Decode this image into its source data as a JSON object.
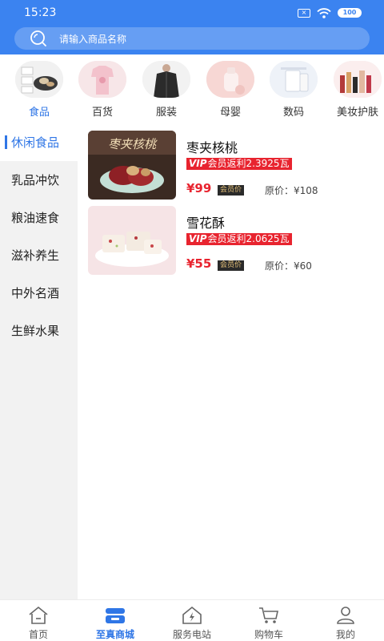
{
  "status": {
    "time": "15:23",
    "battery": "100"
  },
  "search": {
    "placeholder": "请输入商品名称"
  },
  "categories": [
    {
      "label": "食品",
      "active": true
    },
    {
      "label": "百货"
    },
    {
      "label": "服装"
    },
    {
      "label": "母婴"
    },
    {
      "label": "数码"
    },
    {
      "label": "美妆护肤"
    }
  ],
  "sidebar": {
    "items": [
      {
        "label": "休闲食品",
        "active": true
      },
      {
        "label": "乳品冲饮"
      },
      {
        "label": "粮油速食"
      },
      {
        "label": "滋补养生"
      },
      {
        "label": "中外名酒"
      },
      {
        "label": "生鲜水果"
      }
    ]
  },
  "products": [
    {
      "name": "枣夹核桃",
      "image_text": "枣夹核桃",
      "vip_mark": "VIP",
      "vip_text": "会员返利2.3925瓦",
      "price": "¥99",
      "member_tag": "会员价",
      "original_price": "原价：¥108"
    },
    {
      "name": "雪花酥",
      "vip_mark": "VIP",
      "vip_text": "会员返利2.0625瓦",
      "price": "¥55",
      "member_tag": "会员价",
      "original_price": "原价：¥60"
    }
  ],
  "tabbar": {
    "items": [
      {
        "label": "首页",
        "icon": "home-icon"
      },
      {
        "label": "至真商城",
        "icon": "store-icon",
        "active": true
      },
      {
        "label": "服务电站",
        "icon": "power-station-icon"
      },
      {
        "label": "购物车",
        "icon": "cart-icon"
      },
      {
        "label": "我的",
        "icon": "profile-icon"
      }
    ]
  },
  "colors": {
    "primary": "#3b83f0",
    "accent_blue": "#2f76e6",
    "vip_red": "#e8242f"
  }
}
